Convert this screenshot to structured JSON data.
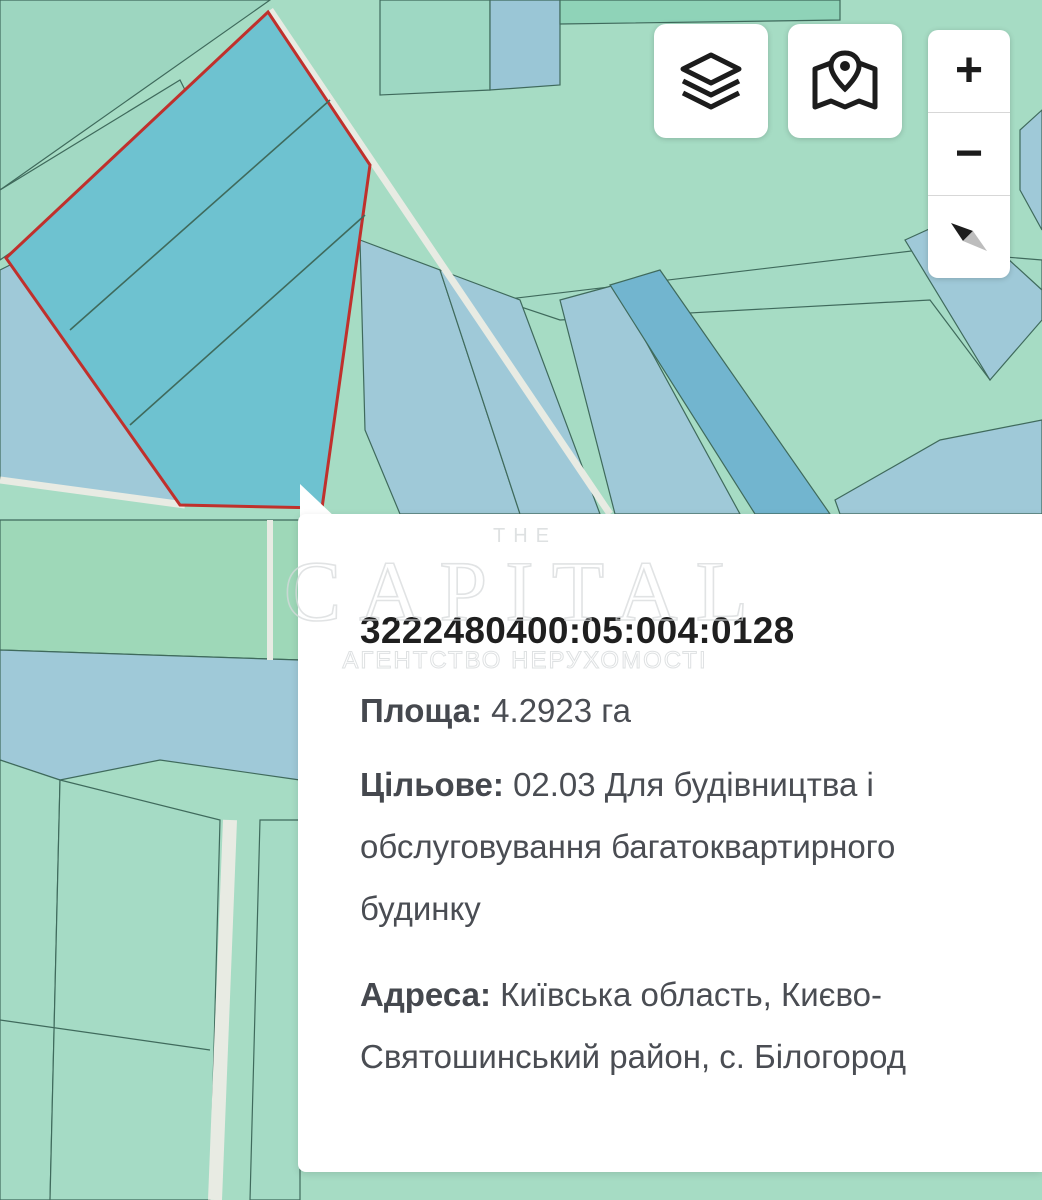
{
  "map": {
    "colors": {
      "land": "#a6dcc4",
      "parcel_blue": "#9fc9d8",
      "parcel_teal": "#79c9d4",
      "selected_fill": "#6ec2d0",
      "selected_outline": "#c0302c",
      "road": "#e8ebe3"
    },
    "selected_parcel": true
  },
  "controls": {
    "layers_icon": "layers-icon",
    "basemap_icon": "map-pin-icon",
    "zoom_in_label": "+",
    "zoom_out_label": "−",
    "compass_icon": "compass-icon"
  },
  "popup": {
    "cadastral_number": "3222480400:05:004:0128",
    "area_label": "Площа:",
    "area_value": "4.2923 га",
    "purpose_label": "Цільове:",
    "purpose_value_lines": [
      "02.03 Для будівництва і",
      "обслуговування багатоквартирного",
      "будинку"
    ],
    "address_label": "Адреса:",
    "address_value_lines": [
      "Київська область, Києво-",
      "Святошинський район, с. Білогород"
    ]
  },
  "watermark": {
    "top": "THE",
    "main": "CAPITAL",
    "sub": "АГЕНТСТВО НЕРУХОМОСТІ"
  }
}
